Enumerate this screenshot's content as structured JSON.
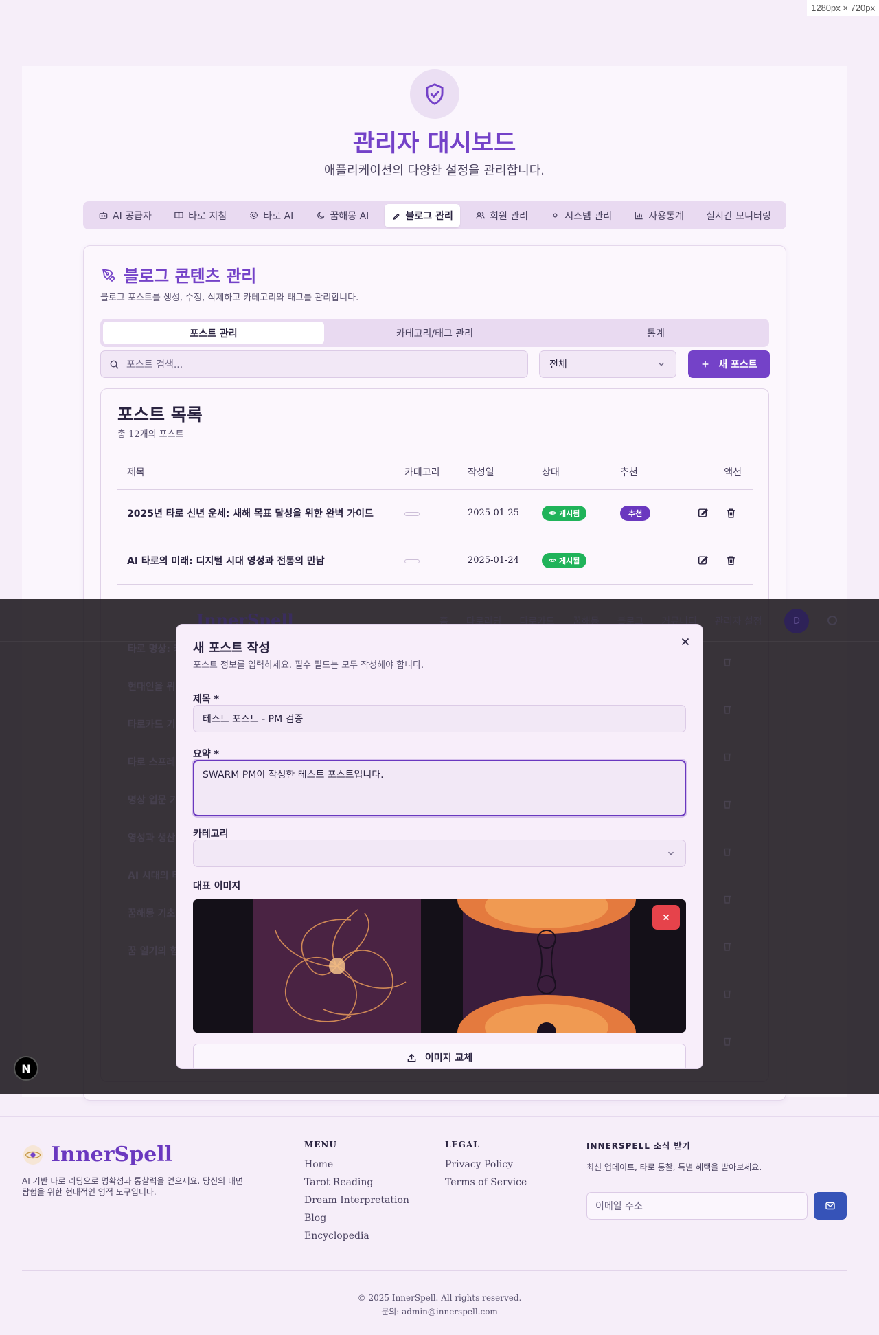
{
  "viewport_badge": "1280px × 720px",
  "header": {
    "title": "관리자 대시보드",
    "subtitle": "애플리케이션의 다양한 설정을 관리합니다."
  },
  "admin_tabs": [
    {
      "label": "AI 공급자",
      "icon": "bot-icon"
    },
    {
      "label": "타로 지침",
      "icon": "book-icon"
    },
    {
      "label": "타로 AI",
      "icon": "gear-icon"
    },
    {
      "label": "꿈해몽 AI",
      "icon": "moon-icon"
    },
    {
      "label": "블로그 관리",
      "icon": "pen-icon",
      "active": true
    },
    {
      "label": "회원 관리",
      "icon": "users-icon"
    },
    {
      "label": "시스템 관리",
      "icon": "dot-icon"
    },
    {
      "label": "사용통계",
      "icon": "chart-icon"
    },
    {
      "label": "실시간 모니터링",
      "icon": ""
    }
  ],
  "blog": {
    "title": "블로그 콘텐츠 관리",
    "description": "블로그 포스트를 생성, 수정, 삭제하고 카테고리와 태그를 관리합니다.",
    "subtabs": [
      "포스트 관리",
      "카테고리/태그 관리",
      "통계"
    ],
    "search_placeholder": "포스트 검색...",
    "filter_value": "전체",
    "new_post_label": "새 포스트"
  },
  "post_list": {
    "title": "포스트 목록",
    "count": "총 12개의 포스트",
    "columns": [
      "제목",
      "카테고리",
      "작성일",
      "상태",
      "추천",
      "액션"
    ],
    "rows": [
      {
        "title": "2025년 타로 신년 운세: 새해 목표 달성을 위한 완벽 가이드",
        "date": "2025-01-25",
        "status": "게시됨",
        "featured": "추천"
      },
      {
        "title": "AI 타로의 미래: 디지털 시대 영성과 전통의 만남",
        "date": "2025-01-24",
        "status": "게시됨",
        "featured": ""
      }
    ]
  },
  "background_nav": {
    "brand": "InnerSpell",
    "links": [
      "홈",
      "타로리딩",
      "타로카드",
      "꿈해몽",
      "블로그",
      "커뮤니티",
      "관리자 설정"
    ],
    "avatar": "D"
  },
  "background_rows": [
    "타로 명상: 카",
    "현대인을 위",
    "타로카드 기",
    "타로 스프레",
    "명상 입문 가",
    "영성과 생산",
    "AI 시대의 타",
    "꿈해몽 기초",
    "꿈 일기의 힘"
  ],
  "dev_badge": "N",
  "modal": {
    "title": "새 포스트 작성",
    "description": "포스트 정보를 입력하세요. 필수 필드는 모두 작성해야 합니다.",
    "title_label": "제목 *",
    "title_value": "테스트 포스트 - PM 검증",
    "summary_label": "요약 *",
    "summary_value": "SWARM PM이 작성한 테스트 포스트입니다.",
    "category_label": "카테고리",
    "category_value": "",
    "image_label": "대표 이미지",
    "replace_label": "이미지 교체"
  },
  "footer": {
    "brand": "InnerSpell",
    "tagline": "AI 기반 타로 리딩으로 명확성과 통찰력을 얻으세요. 당신의 내면 탐험을 위한 현대적인 영적 도구입니다.",
    "menu_heading": "MENU",
    "menu_links": [
      "Home",
      "Tarot Reading",
      "Dream Interpretation",
      "Blog",
      "Encyclopedia"
    ],
    "legal_heading": "LEGAL",
    "legal_links": [
      "Privacy Policy",
      "Terms of Service"
    ],
    "newsletter_heading": "INNERSPELL 소식 받기",
    "newsletter_desc": "최신 업데이트, 타로 통찰, 특별 혜택을 받아보세요.",
    "email_placeholder": "이메일 주소",
    "copyright": "© 2025 InnerSpell. All rights reserved.",
    "contact": "문의: admin@innerspell.com"
  },
  "colors": {
    "accent": "#7442c8",
    "published": "#20b35a",
    "danger": "#e6434b",
    "send": "#3653b8"
  }
}
